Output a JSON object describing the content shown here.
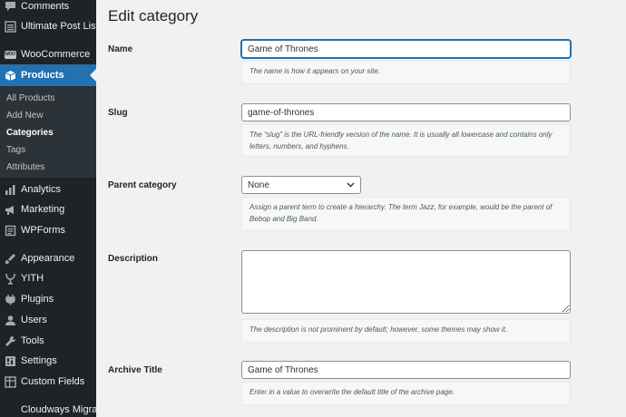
{
  "sidebar": {
    "items": [
      {
        "label": "Comments",
        "icon": "comments-icon"
      },
      {
        "label": "Ultimate Post List",
        "icon": "list-icon"
      },
      {
        "label": "WooCommerce",
        "icon": "woocommerce-icon",
        "badge": "WOO"
      },
      {
        "label": "Products",
        "icon": "products-icon"
      },
      {
        "label": "Analytics",
        "icon": "analytics-icon"
      },
      {
        "label": "Marketing",
        "icon": "marketing-icon"
      },
      {
        "label": "WPForms",
        "icon": "wpforms-icon"
      },
      {
        "label": "Appearance",
        "icon": "appearance-icon"
      },
      {
        "label": "YITH",
        "icon": "yith-icon"
      },
      {
        "label": "Plugins",
        "icon": "plugins-icon"
      },
      {
        "label": "Users",
        "icon": "users-icon"
      },
      {
        "label": "Tools",
        "icon": "tools-icon"
      },
      {
        "label": "Settings",
        "icon": "settings-icon"
      },
      {
        "label": "Custom Fields",
        "icon": "custom-fields-icon"
      },
      {
        "label": "Cloudways Migrate",
        "icon": "cloudways-icon"
      }
    ],
    "submenu": [
      "All Products",
      "Add New",
      "Categories",
      "Tags",
      "Attributes"
    ]
  },
  "page": {
    "title": "Edit category"
  },
  "form": {
    "name": {
      "label": "Name",
      "value": "Game of Thrones",
      "help": "The name is how it appears on your site."
    },
    "slug": {
      "label": "Slug",
      "value": "game-of-thrones",
      "help": "The “slug” is the URL-friendly version of the name. It is usually all lowercase and contains only letters, numbers, and hyphens."
    },
    "parent": {
      "label": "Parent category",
      "value": "None",
      "help": "Assign a parent term to create a hierarchy. The term Jazz, for example, would be the parent of Bebop and Big Band."
    },
    "description": {
      "label": "Description",
      "value": "",
      "help": "The description is not prominent by default; however, some themes may show it."
    },
    "archive_title": {
      "label": "Archive Title",
      "value": "Game of Thrones",
      "help": "Enter in a value to overwrite the default title of the archive page."
    }
  },
  "colors": {
    "sidebar_bg": "#1d2327",
    "submenu_bg": "#2c3338",
    "accent": "#2271b1",
    "page_bg": "#f1f1f1"
  }
}
